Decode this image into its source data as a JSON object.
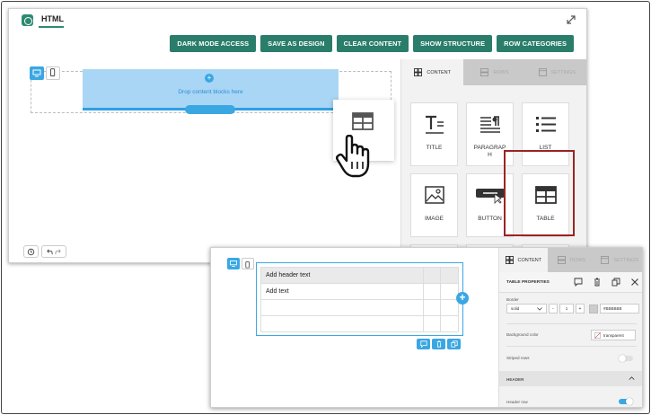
{
  "app": {
    "title": "HTML"
  },
  "toolbar": {
    "dark_mode": "DARK MODE ACCESS",
    "save_design": "SAVE AS DESIGN",
    "clear_content": "CLEAR CONTENT",
    "show_structure": "SHOW STRUCTURE",
    "row_categories": "ROW CATEGORIES"
  },
  "canvas": {
    "drop_text": "Drop content blocks here"
  },
  "panel": {
    "tabs": {
      "content": "CONTENT",
      "rows": "ROWS",
      "settings": "SETTINGS"
    },
    "blocks": [
      {
        "label": "TITLE",
        "icon": "title-icon"
      },
      {
        "label": "PARAGRAP\nH",
        "icon": "paragraph-icon"
      },
      {
        "label": "LIST",
        "icon": "list-icon"
      },
      {
        "label": "IMAGE",
        "icon": "image-icon"
      },
      {
        "label": "BUTTON",
        "icon": "button-icon"
      },
      {
        "label": "TABLE",
        "icon": "table-icon"
      }
    ]
  },
  "table": {
    "header_cell": "Add header text",
    "body_cell": "Add text"
  },
  "props": {
    "title": "TABLE PROPERTIES",
    "border_label": "Border",
    "border_style": "solid",
    "border_width": "1",
    "border_color": "#BBBBBB",
    "bg_label": "Background color",
    "bg_value": "transparent",
    "striped_label": "Striped rows",
    "header_section": "HEADER",
    "header_row_label": "Header row"
  },
  "colors": {
    "brand": "#2a7d6a",
    "accent": "#3aa7e3",
    "highlight": "#9b2424"
  }
}
